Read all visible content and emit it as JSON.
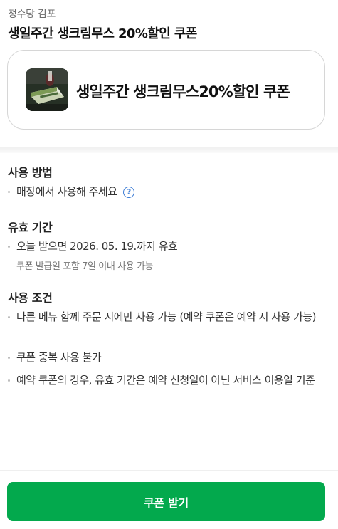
{
  "header": {
    "store_name": "청수당 김포",
    "coupon_title": "생일주간 생크림무스 20%할인 쿠폰"
  },
  "coupon_card": {
    "image_icon": "cake-photo",
    "text": "생일주간 생크림무스20%할인 쿠폰"
  },
  "sections": {
    "usage": {
      "heading": "사용 방법",
      "item": "매장에서 사용해 주세요",
      "help_icon": "question-circle-icon",
      "help_glyph": "?"
    },
    "validity": {
      "heading": "유효 기간",
      "item": "오늘 받으면 2026. 05. 19.까지 유효",
      "note": "쿠폰 발급일 포함 7일 이내 사용 가능"
    },
    "conditions": {
      "heading": "사용 조건",
      "items": [
        "다른 메뉴 함께 주문 시에만 사용 가능 (예약 쿠폰은 예약 시 사용 가능)",
        "쿠폰 중복 사용 불가",
        "예약 쿠폰의 경우, 유효 기간은 예약 신청일이 아닌 서비스 이용일 기준"
      ]
    }
  },
  "cta": {
    "label": "쿠폰 받기",
    "color": "#03a94d"
  }
}
